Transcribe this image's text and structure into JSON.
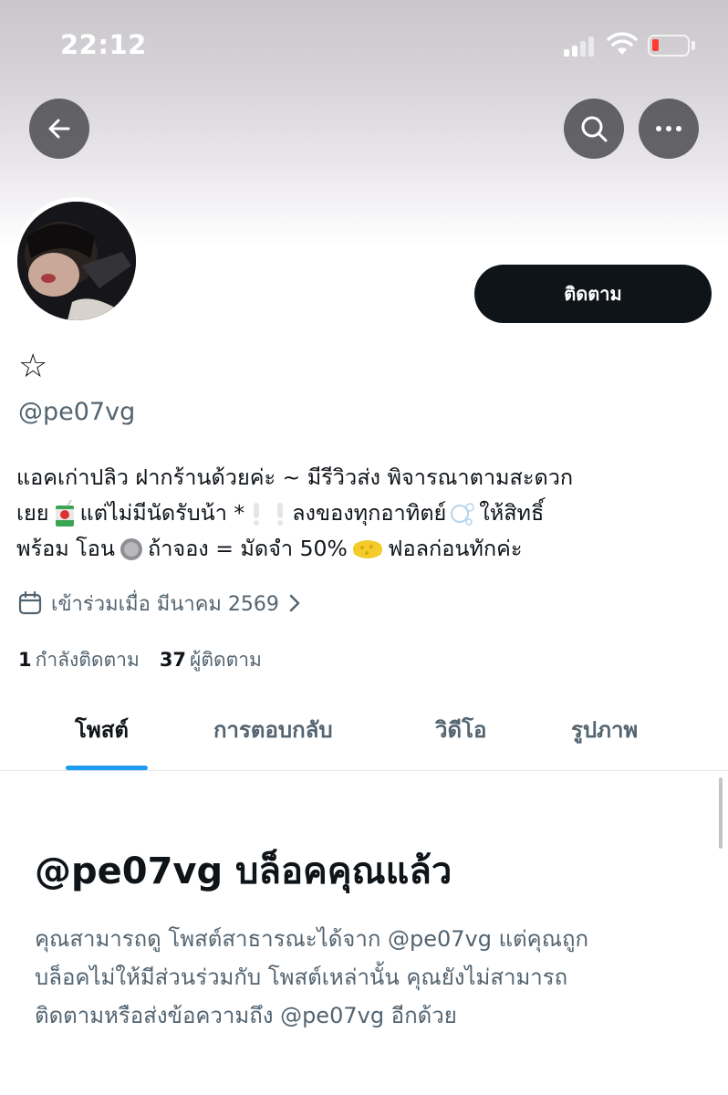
{
  "status_bar": {
    "time": "22:12"
  },
  "header": {
    "back_icon": "arrow-left-icon",
    "search_icon": "search-icon",
    "more_icon": "more-horizontal-icon"
  },
  "profile": {
    "follow_label": "ติดตาม",
    "display_name": "☆",
    "handle": "@pe07vg",
    "bio_lines": [
      [
        "แอคเก่าปลิว ฝากร้านด้วยค่ะ ~ มีรีวิวส่ง พิจารณาตามสะดวก"
      ],
      [
        "เยย",
        "แต่ไม่มีนัดรับน้า *",
        "ลงของทุกอาทิตย์",
        "ให้สิทธิ์"
      ],
      [
        "พร้อม โอน",
        "ถ้าจอง = มัดจำ 50%",
        "ฟอลก่อนทักค่ะ"
      ]
    ],
    "joined": "เข้าร่วมเมื่อ มีนาคม 2569",
    "following_count": "1",
    "following_label": "กำลังติดตาม",
    "followers_count": "37",
    "followers_label": "ผู้ติดตาม"
  },
  "tabs": [
    "โพสต์",
    "การตอบกลับ",
    "วิดีโอ",
    "รูปภาพ"
  ],
  "active_tab": "โพสต์",
  "blocked": {
    "title": "@pe07vg บล็อคคุณแล้ว",
    "lines": [
      "คุณสามารถดู โพสต์สาธารณะได้จาก @pe07vg แต่คุณถูก",
      "บล็อคไม่ให้มีส่วนร่วมกับ โพสต์เหล่านั้น คุณยังไม่สามารถ",
      "ติดตามหรือส่งข้อความถึง @pe07vg อีกด้วย"
    ]
  },
  "colors": {
    "accent": "#1d9bf0",
    "text_primary": "#0f1419",
    "text_secondary": "#536471",
    "battery_low": "#ff3b30"
  }
}
